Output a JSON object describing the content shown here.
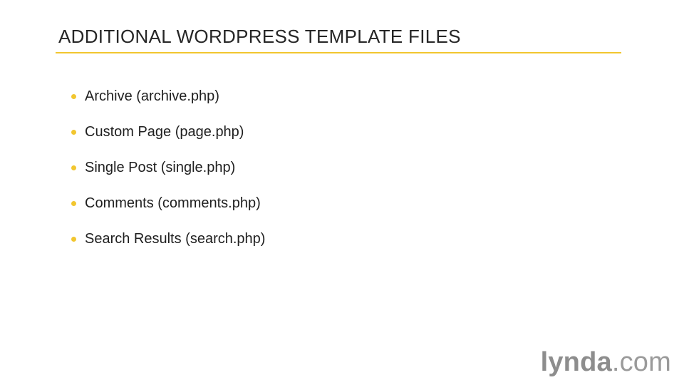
{
  "slide": {
    "title": "ADDITIONAL WORDPRESS TEMPLATE FILES",
    "accent_color": "#f2c62f",
    "bullets": [
      {
        "text": "Archive (archive.php)"
      },
      {
        "text": "Custom Page (page.php)"
      },
      {
        "text": "Single Post (single.php)"
      },
      {
        "text": "Comments (comments.php)"
      },
      {
        "text": "Search Results (search.php)"
      }
    ]
  },
  "logo": {
    "brand": "lynda",
    "suffix": ".com"
  }
}
